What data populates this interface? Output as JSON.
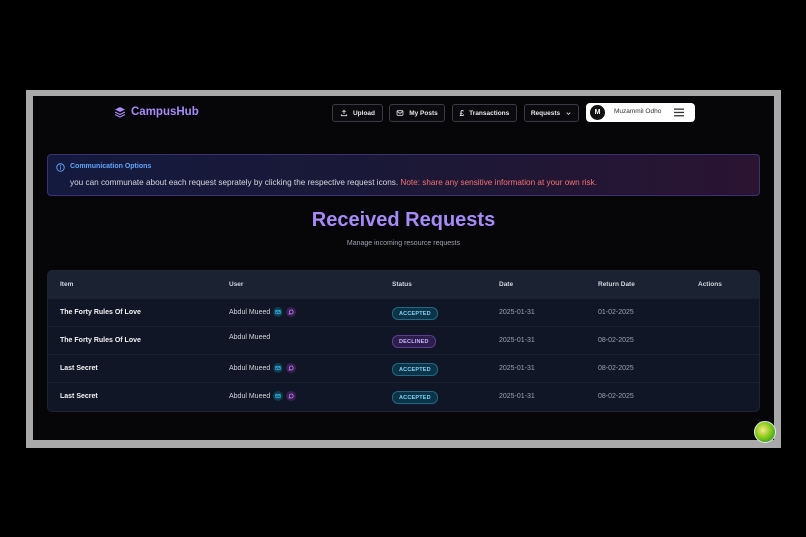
{
  "app": {
    "name": "CampusHub"
  },
  "nav": {
    "upload": "Upload",
    "my_posts": "My Posts",
    "transactions": "Transactions",
    "requests": "Requests"
  },
  "user": {
    "initial": "M",
    "name": "Muzammil Odho"
  },
  "alert": {
    "title": "Communication Options",
    "body": "you can communate about each request seprately by clicking the respective request icons.",
    "note": "Note: share any sensitive information at your own risk."
  },
  "page": {
    "title": "Received Requests",
    "subtitle": "Manage incoming resource requests"
  },
  "table": {
    "headers": [
      "Item",
      "User",
      "Status",
      "Date",
      "Return Date",
      "Actions"
    ],
    "rows": [
      {
        "item": "The Forty Rules Of Love",
        "user": "Abdul Mueed",
        "status": "ACCEPTED",
        "date": "2025-01-31",
        "return_date": "01-02-2025"
      },
      {
        "item": "The Forty Rules Of Love",
        "user": "Abdul Mueed",
        "status": "DECLINED",
        "date": "2025-01-31",
        "return_date": "08-02-2025"
      },
      {
        "item": "Last Secret",
        "user": "Abdul Mueed",
        "status": "ACCEPTED",
        "date": "2025-01-31",
        "return_date": "08-02-2025"
      },
      {
        "item": "Last Secret",
        "user": "Abdul Mueed",
        "status": "ACCEPTED",
        "date": "2025-01-31",
        "return_date": "08-02-2025"
      }
    ]
  },
  "colors": {
    "accent": "#a78bfa",
    "info": "#60a5fa",
    "warning": "#f87171",
    "accepted": "#7dd3fc",
    "declined": "#c4b5fd"
  }
}
